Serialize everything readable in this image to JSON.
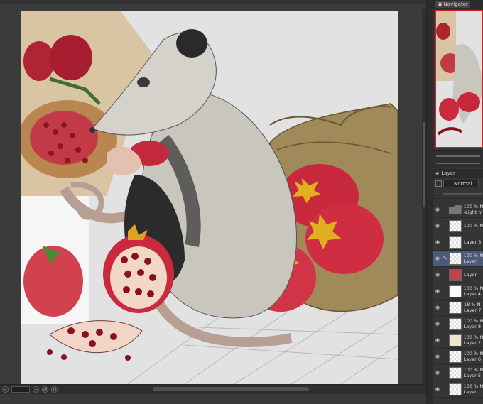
{
  "navigator": {
    "tab_label": "Navigator"
  },
  "layer_panel": {
    "tab_label": "Layer",
    "blend_mode": "Normal"
  },
  "layers": [
    {
      "line1": "100 % N",
      "line2": "-Light m",
      "thumb": "folder",
      "pen": false,
      "selected": false
    },
    {
      "line1": "100 % N",
      "line2": "",
      "thumb": "checker",
      "pen": false,
      "selected": false
    },
    {
      "line1": "",
      "line2": "Layer 3",
      "thumb": "checker",
      "pen": false,
      "selected": false
    },
    {
      "line1": "100 % N",
      "line2": "Layer",
      "thumb": "checker",
      "pen": true,
      "selected": true
    },
    {
      "line1": "",
      "line2": "Layer",
      "thumb": "pom",
      "pen": false,
      "selected": false
    },
    {
      "line1": "100 % N",
      "line2": "Layer 4",
      "thumb": "white",
      "pen": false,
      "selected": false
    },
    {
      "line1": "18 % N",
      "line2": "Layer 7",
      "thumb": "checker",
      "pen": false,
      "selected": false
    },
    {
      "line1": "100 % N",
      "line2": "Layer 8",
      "thumb": "checker",
      "pen": false,
      "selected": false
    },
    {
      "line1": "100 % N",
      "line2": "Layer 2",
      "thumb": "cream",
      "pen": false,
      "selected": false
    },
    {
      "line1": "100 % N",
      "line2": "Layer 6",
      "thumb": "checker",
      "pen": false,
      "selected": false
    },
    {
      "line1": "100 % N",
      "line2": "Layer 5",
      "thumb": "checker",
      "pen": false,
      "selected": false
    },
    {
      "line1": "100 % N",
      "line2": "Layer",
      "thumb": "checker",
      "pen": false,
      "selected": false
    }
  ],
  "colors": {
    "canvas_bg": "#e2e2e2",
    "pomegranate": "#c8283c",
    "sack": "#a89060",
    "possum_fur": "#c9c7bd",
    "selection": "#4a5a78"
  }
}
